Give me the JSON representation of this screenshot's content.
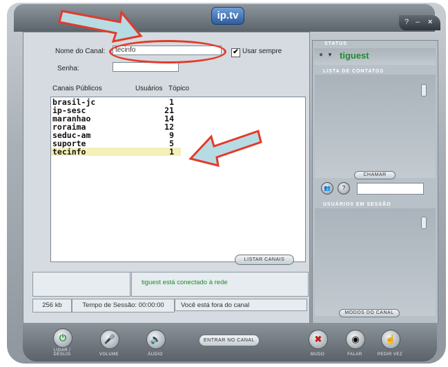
{
  "app": {
    "logo": "ip.tv",
    "win_help": "?",
    "win_min": "–",
    "win_close": "×"
  },
  "form": {
    "channel_label": "Nome do Canal:",
    "channel_value": "tecinfo",
    "always_label": "Usar sempre",
    "always_checked": "✔",
    "password_label": "Senha:",
    "password_value": ""
  },
  "table": {
    "headers": {
      "channels": "Canais Públicos",
      "users": "Usuários",
      "topic": "Tópico"
    },
    "rows": [
      {
        "name": "brasil-jc",
        "users": "1"
      },
      {
        "name": "ip-sesc",
        "users": "21"
      },
      {
        "name": "maranhao",
        "users": "14"
      },
      {
        "name": "roraima",
        "users": "12"
      },
      {
        "name": "seduc-am",
        "users": "9"
      },
      {
        "name": "suporte",
        "users": "5"
      },
      {
        "name": "tecinfo",
        "users": "1"
      }
    ],
    "list_button": "LISTAR CANAIS"
  },
  "messages": {
    "connected": "tiguest está conectado à rede"
  },
  "statusbar": {
    "size": "256 kb",
    "session_time": "Tempo de Sessão: 00:00:00",
    "channel_status": "Você está fora do canal"
  },
  "right_panel": {
    "status_header": "STATUS",
    "user": "tiguest",
    "contacts_header": "LISTA DE CONTATOS",
    "call_button": "CHAMAR",
    "session_users_header": "USUÁRIOS EM SESSÃO",
    "channel_mode_button": "MODOS DO CANAL"
  },
  "controls": {
    "power": "LIGAR / DESLIG",
    "volume": "VOLUME",
    "audio": "ÁUDIO",
    "enter_channel": "ENTRAR NO CANAL",
    "mute": "MUDO",
    "speak": "FALAR",
    "ask": "PEDIR VEZ"
  },
  "colors": {
    "accent_green": "#1f8a2c",
    "highlight": "#f3f0b8",
    "annotation_red": "#e23a2a"
  }
}
